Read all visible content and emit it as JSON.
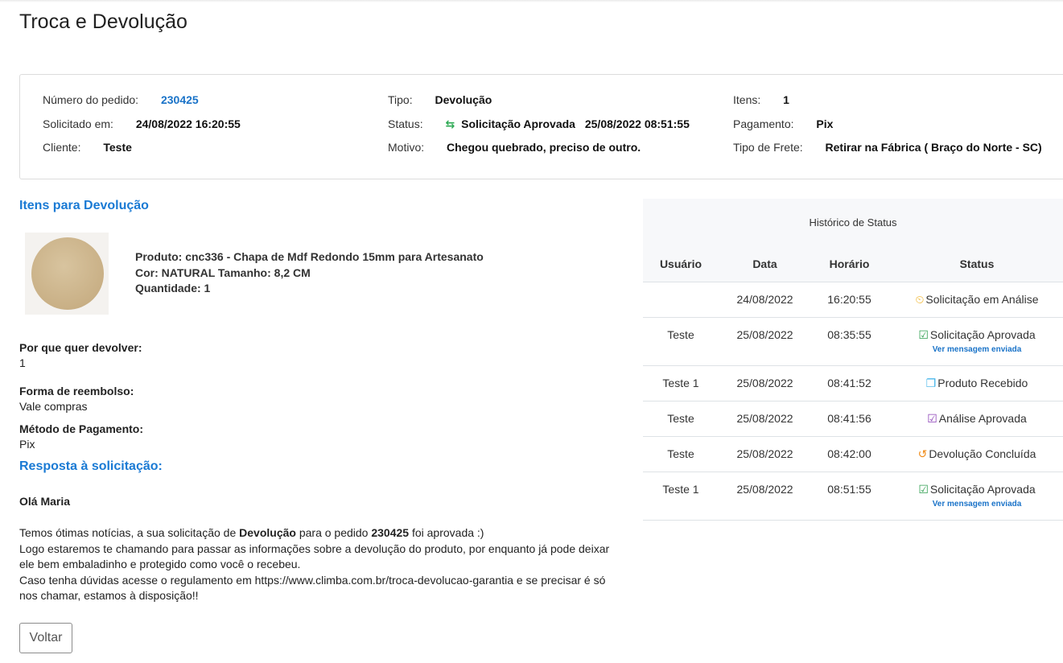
{
  "page": {
    "title": "Troca e Devolução"
  },
  "info": {
    "order_label": "Número do pedido:",
    "order_value": "230425",
    "requested_label": "Solicitado em:",
    "requested_value": "24/08/2022 16:20:55",
    "client_label": "Cliente:",
    "client_value": "Teste",
    "type_label": "Tipo:",
    "type_value": "Devolução",
    "status_label": "Status:",
    "status_value": "Solicitação Aprovada",
    "status_date": "25/08/2022 08:51:55",
    "status_icon": "swap-arrows-icon",
    "reason_label": "Motivo:",
    "reason_value": "Chegou quebrado, preciso de outro.",
    "items_label": "Itens:",
    "items_value": "1",
    "payment_label": "Pagamento:",
    "payment_value": "Pix",
    "shipping_label": "Tipo de Frete:",
    "shipping_value": "Retirar na Fábrica ( Braço do Norte - SC)"
  },
  "items_section": {
    "title": "Itens para Devolução",
    "product": "Produto: cnc336 - Chapa de Mdf Redondo 15mm para Artesanato",
    "variant": "Cor: NATURAL Tamanho: 8,2 CM",
    "quantity": "Quantidade: 1"
  },
  "details": {
    "why_label": "Por que quer devolver:",
    "why_value": "1",
    "refund_label": "Forma de reembolso:",
    "refund_value": "Vale compras",
    "method_label": "Método de Pagamento:",
    "method_value": "Pix"
  },
  "response": {
    "title": "Resposta à solicitação:",
    "greeting": "Olá Maria",
    "p1_a": "Temos ótimas notícias, a sua solicitação de ",
    "p1_b": "Devolução",
    "p1_c": " para o pedido ",
    "p1_d": "230425",
    "p1_e": " foi aprovada :)",
    "p2": "Logo estaremos te chamando para passar as informações sobre a devolução do produto, por enquanto já pode deixar ele bem embaladinho e protegido como você o recebeu.",
    "p3": "Caso tenha dúvidas acesse o regulamento em https://www.climba.com.br/troca-devolucao-garantia e se precisar é só nos chamar, estamos à disposição!!"
  },
  "back_button": "Voltar",
  "history": {
    "title": "Histórico de Status",
    "columns": [
      "Usuário",
      "Data",
      "Horário",
      "Status"
    ],
    "rows": [
      {
        "user": "",
        "date": "24/08/2022",
        "time": "16:20:55",
        "status": "Solicitação em Análise",
        "icon": "clock-icon",
        "color": "#f0b429",
        "link": ""
      },
      {
        "user": "Teste",
        "date": "25/08/2022",
        "time": "08:35:55",
        "status": "Solicitação Aprovada",
        "icon": "checkbox-icon",
        "color": "#2e9e4f",
        "link": "Ver mensagem enviada"
      },
      {
        "user": "Teste 1",
        "date": "25/08/2022",
        "time": "08:41:52",
        "status": "Produto Recebido",
        "icon": "box-icon",
        "color": "#3ab0e8",
        "link": ""
      },
      {
        "user": "Teste",
        "date": "25/08/2022",
        "time": "08:41:56",
        "status": "Análise Aprovada",
        "icon": "check-square-icon",
        "color": "#8a3db6",
        "link": ""
      },
      {
        "user": "Teste",
        "date": "25/08/2022",
        "time": "08:42:00",
        "status": "Devolução Concluída",
        "icon": "undo-icon",
        "color": "#f08c1a",
        "link": ""
      },
      {
        "user": "Teste 1",
        "date": "25/08/2022",
        "time": "08:51:55",
        "status": "Solicitação Aprovada",
        "icon": "checkbox-icon",
        "color": "#2e9e4f",
        "link": "Ver mensagem enviada"
      }
    ]
  }
}
